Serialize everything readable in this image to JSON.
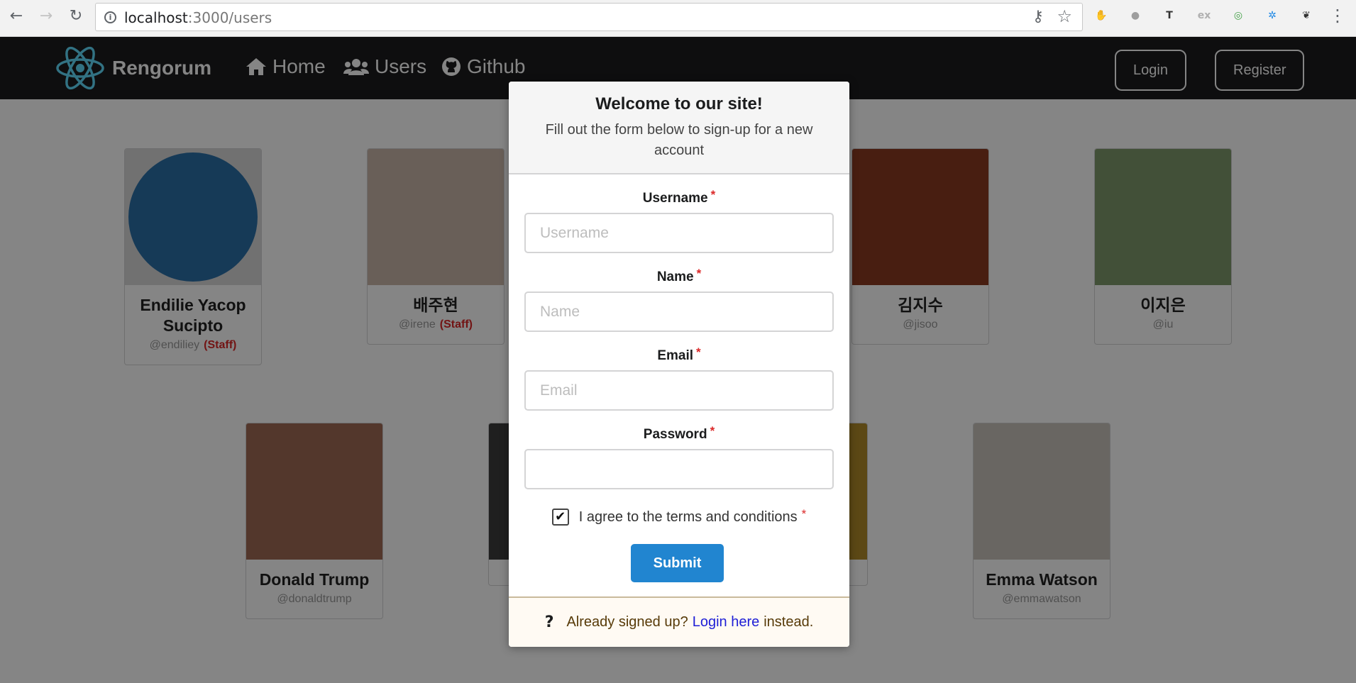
{
  "browser": {
    "url_host": "localhost",
    "url_path": ":3000/users",
    "extensions": [
      {
        "icon": "adblock-icon",
        "glyph": "✋",
        "color": "#e53935"
      },
      {
        "icon": "cloud-icon",
        "glyph": "●",
        "color": "#9e9e9e"
      },
      {
        "icon": "font-t-icon",
        "glyph": "T",
        "color": "#333333"
      },
      {
        "icon": "ex-icon",
        "glyph": "ex",
        "color": "#b0b0b0"
      },
      {
        "icon": "target-icon",
        "glyph": "◎",
        "color": "#43a047"
      },
      {
        "icon": "flower-icon",
        "glyph": "✲",
        "color": "#1e88e5"
      },
      {
        "icon": "brain-icon",
        "glyph": "❦",
        "color": "#333333"
      }
    ]
  },
  "navbar": {
    "brand": "Rengorum",
    "items": [
      {
        "label": "Home",
        "icon": "home-icon"
      },
      {
        "label": "Users",
        "icon": "users-icon"
      },
      {
        "label": "Github",
        "icon": "github-icon"
      }
    ],
    "login_label": "Login",
    "register_label": "Register"
  },
  "users": [
    {
      "name": "Endilie Yacop Sucipto",
      "handle": "@endiliey",
      "staff": "(Staff)",
      "photo_color": "#2b6fa8"
    },
    {
      "name": "배주현",
      "handle": "@irene",
      "staff": "(Staff)",
      "photo_color": "#c9b6aa"
    },
    {
      "name": "",
      "handle": "",
      "staff": "",
      "photo_color": "#6a5a55"
    },
    {
      "name": "김지수",
      "handle": "@jisoo",
      "staff": "",
      "photo_color": "#8a3b22"
    },
    {
      "name": "이지은",
      "handle": "@iu",
      "staff": "",
      "photo_color": "#7f9a6c"
    },
    {
      "name": "Donald Trump",
      "handle": "@donaldtrump",
      "staff": "",
      "photo_color": "#a06a55"
    },
    {
      "name": "",
      "handle": "",
      "staff": "",
      "photo_color": "#3d3d3d"
    },
    {
      "name": "",
      "handle": "",
      "staff": "",
      "photo_color": "#b08a2a"
    },
    {
      "name": "Emma Watson",
      "handle": "@emmawatson",
      "staff": "",
      "photo_color": "#c9c4bd"
    }
  ],
  "modal": {
    "title": "Welcome to our site!",
    "subtitle": "Fill out the form below to sign-up for a new account",
    "required_mark": "*",
    "fields": [
      {
        "label": "Username",
        "placeholder": "Username",
        "value": ""
      },
      {
        "label": "Name",
        "placeholder": "Name",
        "value": ""
      },
      {
        "label": "Email",
        "placeholder": "Email",
        "value": ""
      },
      {
        "label": "Password",
        "placeholder": "",
        "value": ""
      }
    ],
    "terms_label": "I agree to the terms and conditions",
    "terms_checked": true,
    "submit_label": "Submit",
    "footer": {
      "prefix": "Already signed up?",
      "link": "Login here",
      "suffix": "instead."
    }
  }
}
